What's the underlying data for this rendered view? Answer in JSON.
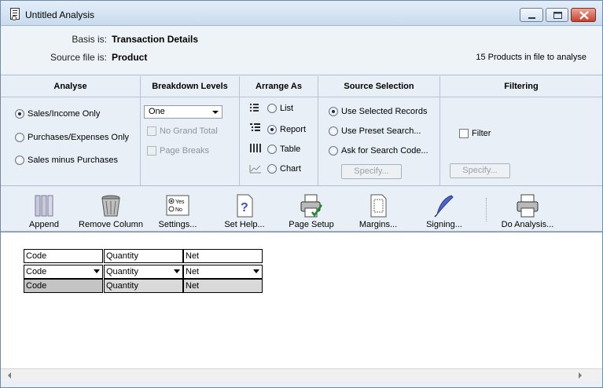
{
  "window": {
    "title": "Untitled Analysis"
  },
  "header": {
    "basis_label": "Basis is:",
    "basis_value": "Transaction Details",
    "source_label": "Source file is:",
    "source_value": "Product",
    "file_info": "15 Products in file to analyse"
  },
  "panels": {
    "analyse": {
      "title": "Analyse",
      "options": [
        {
          "label": "Sales/Income Only",
          "selected": true
        },
        {
          "label": "Purchases/Expenses Only",
          "selected": false
        },
        {
          "label": "Sales minus Purchases",
          "selected": false
        }
      ]
    },
    "breakdown": {
      "title": "Breakdown Levels",
      "selected": "One",
      "checks": [
        {
          "label": "No Grand Total",
          "checked": false,
          "enabled": false
        },
        {
          "label": "Page Breaks",
          "checked": false,
          "enabled": false
        }
      ]
    },
    "arrange": {
      "title": "Arrange As",
      "options": [
        {
          "label": "List",
          "selected": false
        },
        {
          "label": "Report",
          "selected": true
        },
        {
          "label": "Table",
          "selected": false
        },
        {
          "label": "Chart",
          "selected": false
        }
      ]
    },
    "source": {
      "title": "Source Selection",
      "options": [
        {
          "label": "Use Selected Records",
          "selected": true
        },
        {
          "label": "Use Preset Search...",
          "selected": false
        },
        {
          "label": "Ask for Search Code...",
          "selected": false
        }
      ],
      "specify_label": "Specify..."
    },
    "filtering": {
      "title": "Filtering",
      "filter_label": "Filter",
      "filter_checked": false,
      "specify_label": "Specify..."
    }
  },
  "toolbar": {
    "append": "Append",
    "remove_column": "Remove Column",
    "settings": "Settings...",
    "set_help": "Set Help...",
    "page_setup": "Page Setup",
    "margins": "Margins...",
    "signing": "Signing...",
    "do_analysis": "Do Analysis...",
    "settings_icon_yes": "Yes",
    "settings_icon_no": "No"
  },
  "grid": {
    "header_row": [
      "Code",
      "Quantity",
      "Net"
    ],
    "field_row": [
      "Code",
      "Quantity",
      "Net"
    ],
    "sample_row": [
      "Code",
      "Quantity",
      "Net"
    ]
  },
  "colors": {
    "accent": "#e9eff6",
    "close_button": "#c9412c"
  }
}
